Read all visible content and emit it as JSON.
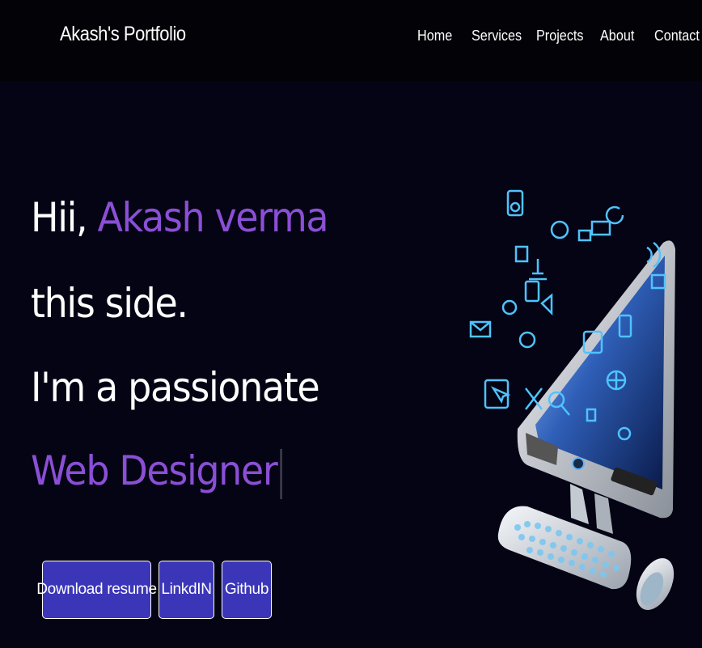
{
  "navbar": {
    "brand": "Akash's Portfolio",
    "links": [
      "Home",
      "Services",
      "Projects",
      "About",
      "Contact"
    ]
  },
  "hero": {
    "greeting": "Hii,",
    "name": "Akash verma",
    "line2": "this side.",
    "line3": "I'm a passionate",
    "role": "Web Designer"
  },
  "buttons": {
    "resume": "Download resume",
    "linkedin": "LinkdIN",
    "github": "Github"
  },
  "colors": {
    "background": "#050414",
    "navbar": "#020207",
    "accent": "#8b4fd6",
    "button": "#3b36b8"
  },
  "illustration": {
    "subject": "computer-with-floating-app-icons"
  }
}
